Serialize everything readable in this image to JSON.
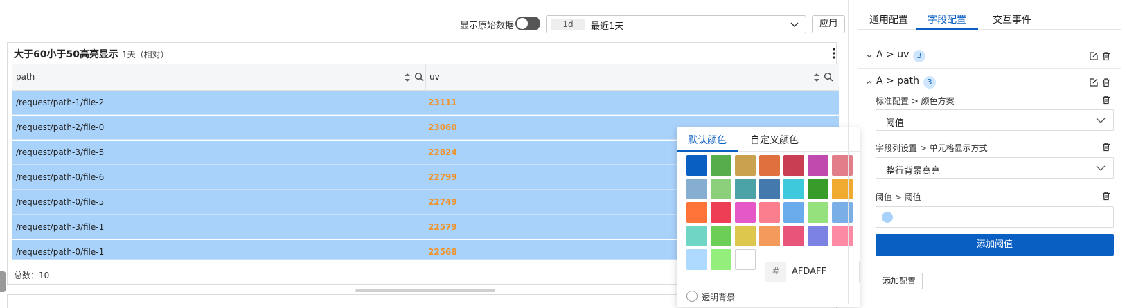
{
  "toolbar": {
    "raw_data_label": "显示原始数据",
    "time_chip": "1d",
    "time_text": "最近1天",
    "apply_label": "应用"
  },
  "panel": {
    "title": "大于60小于50高亮显示",
    "subtitle": "1天（相对）",
    "columns": [
      "path",
      "uv"
    ],
    "rows": [
      {
        "path": "/request/path-1/file-2",
        "uv": "23111"
      },
      {
        "path": "/request/path-2/file-0",
        "uv": "23060"
      },
      {
        "path": "/request/path-3/file-5",
        "uv": "22824"
      },
      {
        "path": "/request/path-0/file-6",
        "uv": "22799"
      },
      {
        "path": "/request/path-0/file-5",
        "uv": "22749"
      },
      {
        "path": "/request/path-3/file-1",
        "uv": "22579"
      },
      {
        "path": "/request/path-0/file-1",
        "uv": "22568"
      }
    ],
    "total": "总数：10",
    "highlight_color": "#a9d2fb",
    "value_color": "#f0922a"
  },
  "picker": {
    "tabs": [
      "默认颜色",
      "自定义颜色"
    ],
    "swatches": [
      [
        "#0a5fc2",
        "#57ad4b",
        "#c9a14f",
        "#e0713e",
        "#c93e52",
        "#c14aae",
        "#e27e89"
      ],
      [
        "#86aed1",
        "#8ccf7b",
        "#4ba3a8",
        "#4479ad",
        "#3ecadc",
        "#389c2b",
        "#f1aa30"
      ],
      [
        "#fe7338",
        "#ee3e55",
        "#e458c7",
        "#fa7e8e",
        "#6aabec",
        "#94e17d",
        "#7aaee6"
      ],
      [
        "#6fd5c5",
        "#6cce56",
        "#ddc74c",
        "#f29b5c",
        "#e9557a",
        "#7b82e2",
        "#fc8aa5"
      ],
      [
        "#afdaff",
        "#94ee7b",
        "#ffffff"
      ]
    ],
    "hex_prefix": "#",
    "hex_value": "AFDAFF",
    "transparent_label": "透明背景"
  },
  "right": {
    "tabs": [
      "通用配置",
      "字段配置",
      "交互事件"
    ],
    "section_uv": {
      "title": "A > uv",
      "badge": "3"
    },
    "section_path": {
      "title": "A > path",
      "badge": "3"
    },
    "field1": {
      "label": "标准配置 > 颜色方案",
      "value": "阈值"
    },
    "field2": {
      "label": "字段列设置 > 单元格显示方式",
      "value": "整行背景高亮"
    },
    "field3": {
      "label": "阈值 > 阈值"
    },
    "add_threshold": "添加阈值",
    "add_config": "添加配置"
  }
}
